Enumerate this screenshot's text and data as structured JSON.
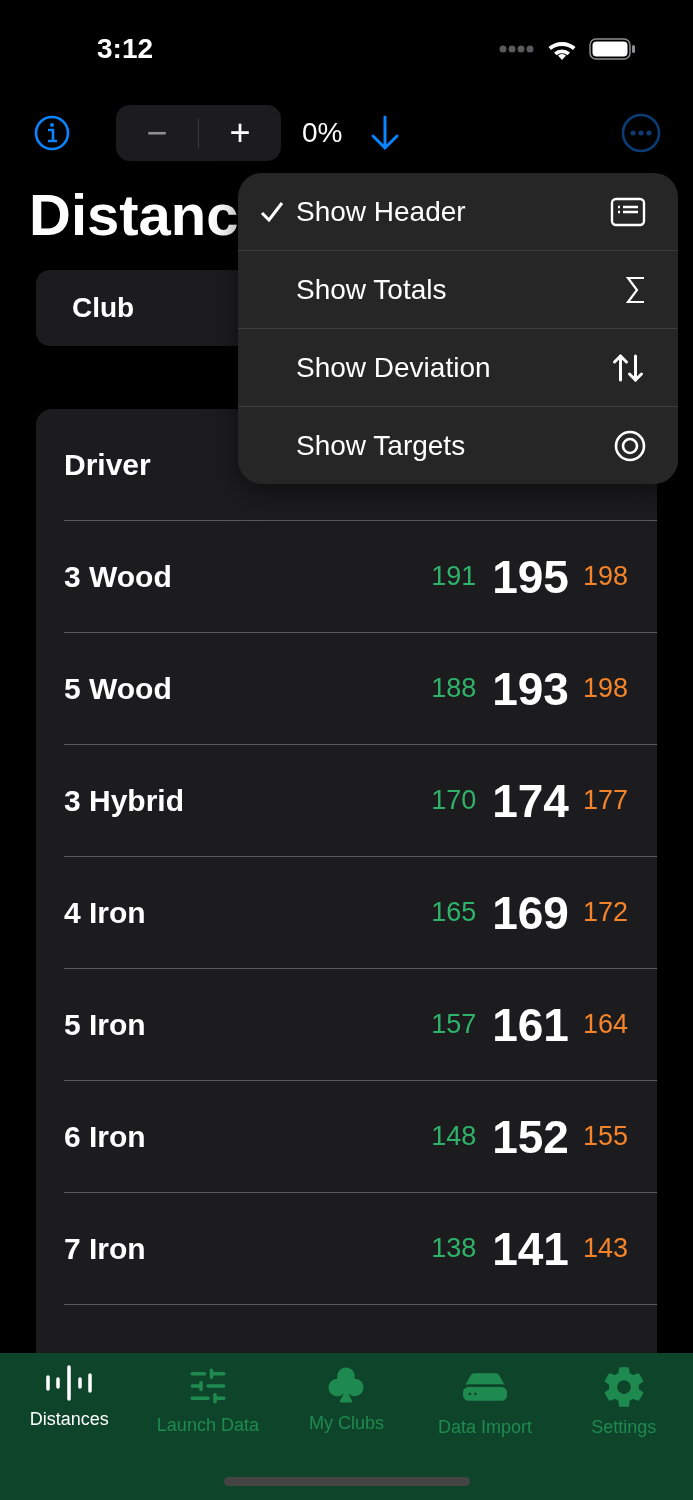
{
  "status_bar": {
    "time": "3:12"
  },
  "toolbar": {
    "stepper": {
      "minus": "−",
      "plus": "+"
    },
    "percent": "0%"
  },
  "title": "Distanc",
  "segmented": {
    "label": "Club"
  },
  "menu": [
    {
      "label": "Show Header",
      "checked": true,
      "kind": "header"
    },
    {
      "label": "Show Totals",
      "checked": false,
      "kind": "sigma"
    },
    {
      "label": "Show Deviation",
      "checked": false,
      "kind": "updown"
    },
    {
      "label": "Show Targets",
      "checked": false,
      "kind": "target"
    }
  ],
  "rows": [
    {
      "club": "Driver"
    },
    {
      "club": "3 Wood",
      "low": "191",
      "mid": "195",
      "high": "198"
    },
    {
      "club": "5 Wood",
      "low": "188",
      "mid": "193",
      "high": "198"
    },
    {
      "club": "3 Hybrid",
      "low": "170",
      "mid": "174",
      "high": "177"
    },
    {
      "club": "4 Iron",
      "low": "165",
      "mid": "169",
      "high": "172"
    },
    {
      "club": "5 Iron",
      "low": "157",
      "mid": "161",
      "high": "164"
    },
    {
      "club": "6 Iron",
      "low": "148",
      "mid": "152",
      "high": "155"
    },
    {
      "club": "7 Iron",
      "low": "138",
      "mid": "141",
      "high": "143"
    }
  ],
  "tabs": [
    {
      "label": "Distances",
      "selected": true,
      "kind": "wave"
    },
    {
      "label": "Launch Data",
      "selected": false,
      "kind": "sliders"
    },
    {
      "label": "My Clubs",
      "selected": false,
      "kind": "club"
    },
    {
      "label": "Data Import",
      "selected": false,
      "kind": "drive"
    },
    {
      "label": "Settings",
      "selected": false,
      "kind": "gear"
    }
  ]
}
